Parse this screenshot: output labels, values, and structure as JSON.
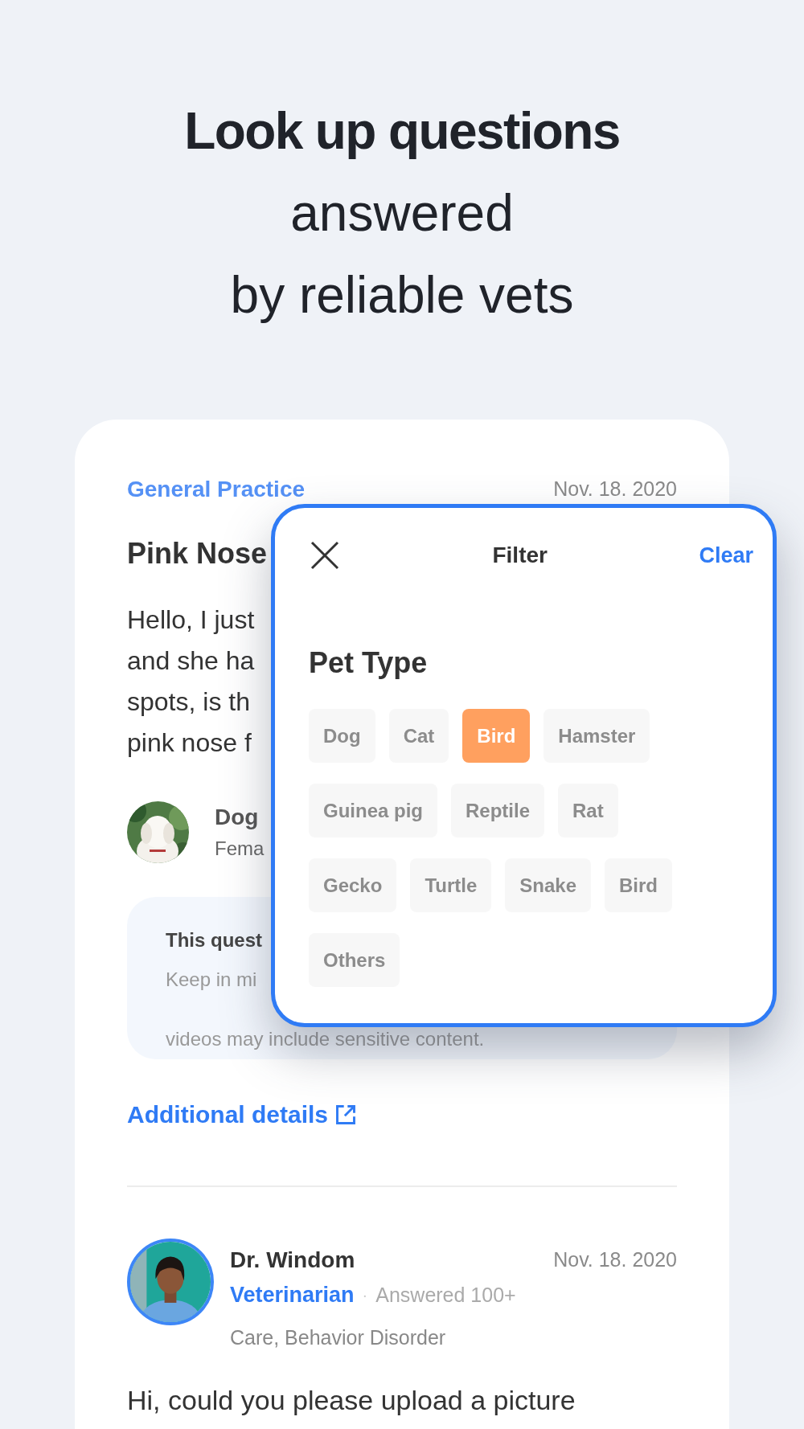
{
  "headline": {
    "bold": "Look up questions",
    "lines": [
      "answered",
      "by reliable vets"
    ]
  },
  "question": {
    "category": "General Practice",
    "date": "Nov. 18. 2020",
    "title": "Pink Nose",
    "body_lines": [
      "Hello, I just",
      "and she ha",
      "spots, is th",
      "pink nose f"
    ],
    "pet": {
      "name": "Dog",
      "detail": "Fema"
    },
    "notice": {
      "title": "This quest",
      "lines": [
        "Keep in mi",
        "videos may include sensitive content."
      ]
    },
    "link": "Additional details"
  },
  "answer": {
    "doctor": "Dr. Windom",
    "date": "Nov. 18. 2020",
    "role": "Veterinarian",
    "separator": "·",
    "answered": "Answered 100+",
    "specialties": "Care, Behavior Disorder",
    "body": "Hi, could you please upload a picture"
  },
  "filter": {
    "title": "Filter",
    "clear": "Clear",
    "section": "Pet Type",
    "options": [
      {
        "label": "Dog",
        "selected": false
      },
      {
        "label": "Cat",
        "selected": false
      },
      {
        "label": "Bird",
        "selected": true
      },
      {
        "label": "Hamster",
        "selected": false
      },
      {
        "label": "Guinea pig",
        "selected": false
      },
      {
        "label": "Reptile",
        "selected": false
      },
      {
        "label": "Rat",
        "selected": false
      },
      {
        "label": "Gecko",
        "selected": false
      },
      {
        "label": "Turtle",
        "selected": false
      },
      {
        "label": "Snake",
        "selected": false
      },
      {
        "label": "Bird",
        "selected": false
      },
      {
        "label": "Others",
        "selected": false
      }
    ]
  }
}
